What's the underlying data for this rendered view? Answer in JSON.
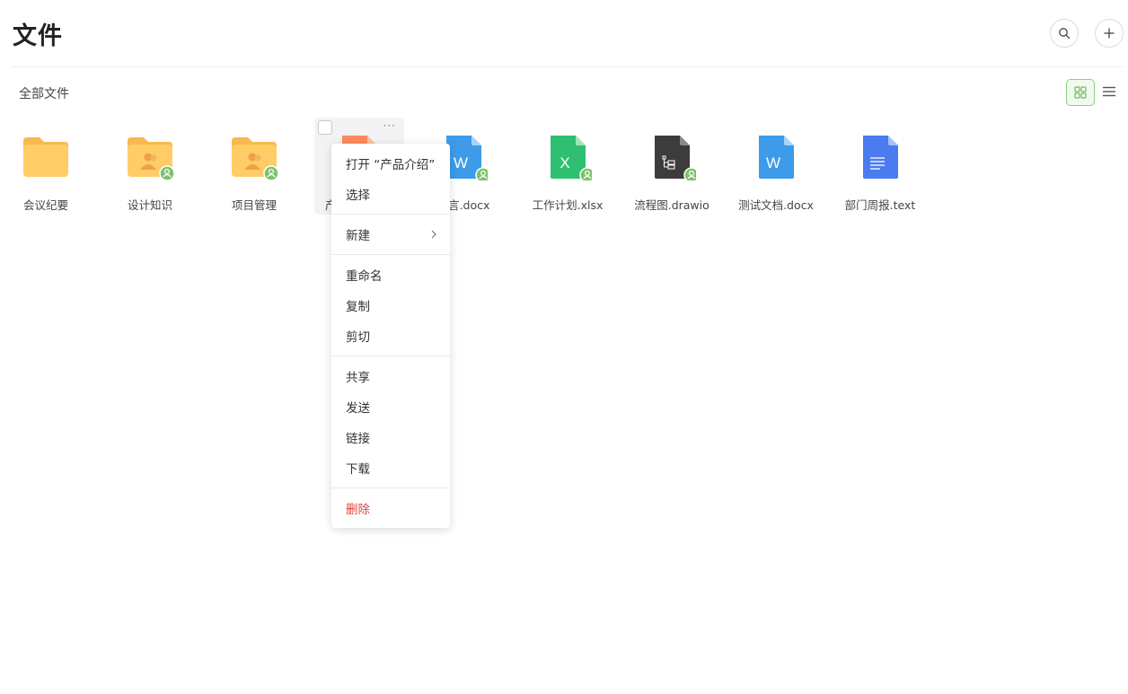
{
  "header": {
    "title": "文件"
  },
  "breadcrumb": "全部文件",
  "files": [
    {
      "name": "会议纪要",
      "type": "folder",
      "shared": false
    },
    {
      "name": "设计知识",
      "type": "folder-shared",
      "shared": true
    },
    {
      "name": "项目管理",
      "type": "folder-shared",
      "shared": true
    },
    {
      "name": "产品介绍",
      "type": "ppt",
      "shared": false,
      "selected": true
    },
    {
      "name": "发言.docx",
      "type": "word",
      "shared": true
    },
    {
      "name": "工作计划.xlsx",
      "type": "excel",
      "shared": true
    },
    {
      "name": "流程图.drawio",
      "type": "drawio",
      "shared": true
    },
    {
      "name": "测试文档.docx",
      "type": "word",
      "shared": false
    },
    {
      "name": "部门周报.text",
      "type": "text",
      "shared": false
    }
  ],
  "selected_file": {
    "more_label": "···",
    "visible_name": "产"
  },
  "context_menu": {
    "open": "打开 “产品介绍”",
    "select": "选择",
    "new": "新建",
    "rename": "重命名",
    "copy": "复制",
    "cut": "剪切",
    "share": "共享",
    "send": "发送",
    "link": "链接",
    "download": "下载",
    "delete": "删除"
  },
  "icons": {
    "word_letter": "W",
    "excel_letter": "X"
  },
  "colors": {
    "accent_green": "#7dc26b",
    "folder": "#ffcc66",
    "word": "#3d9be9",
    "excel": "#2fbf71",
    "drawio": "#3c3c3c",
    "text_doc": "#4a7cf0",
    "danger": "#e2433a"
  }
}
